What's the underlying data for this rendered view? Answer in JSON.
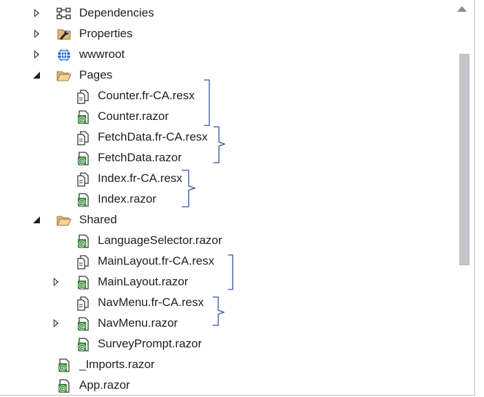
{
  "tree": {
    "items": [
      {
        "label": "Dependencies",
        "icon": "dependencies-icon",
        "expander": "collapsed"
      },
      {
        "label": "Properties",
        "icon": "properties-icon",
        "expander": "collapsed"
      },
      {
        "label": "wwwroot",
        "icon": "globe-icon",
        "expander": "collapsed"
      },
      {
        "label": "Pages",
        "icon": "folder-open-icon",
        "expander": "expanded"
      },
      {
        "label": "Counter.fr-CA.resx",
        "icon": "resx-file-icon",
        "expander": "none"
      },
      {
        "label": "Counter.razor",
        "icon": "razor-file-icon",
        "expander": "none"
      },
      {
        "label": "FetchData.fr-CA.resx",
        "icon": "resx-file-icon",
        "expander": "none"
      },
      {
        "label": "FetchData.razor",
        "icon": "razor-file-icon",
        "expander": "none"
      },
      {
        "label": "Index.fr-CA.resx",
        "icon": "resx-file-icon",
        "expander": "none"
      },
      {
        "label": "Index.razor",
        "icon": "razor-file-icon",
        "expander": "none"
      },
      {
        "label": "Shared",
        "icon": "folder-open-icon",
        "expander": "expanded"
      },
      {
        "label": "LanguageSelector.razor",
        "icon": "razor-file-icon",
        "expander": "none"
      },
      {
        "label": "MainLayout.fr-CA.resx",
        "icon": "resx-file-icon",
        "expander": "none"
      },
      {
        "label": "MainLayout.razor",
        "icon": "razor-file-icon",
        "expander": "collapsed"
      },
      {
        "label": "NavMenu.fr-CA.resx",
        "icon": "resx-file-icon",
        "expander": "none"
      },
      {
        "label": "NavMenu.razor",
        "icon": "razor-file-icon",
        "expander": "collapsed"
      },
      {
        "label": "SurveyPrompt.razor",
        "icon": "razor-file-icon",
        "expander": "none"
      },
      {
        "label": "_Imports.razor",
        "icon": "razor-file-icon",
        "expander": "none"
      },
      {
        "label": "App.razor",
        "icon": "razor-file-icon",
        "expander": "none"
      }
    ]
  },
  "colors": {
    "brace": "#2f4f9e",
    "razor_green": "#3a8a3a",
    "folder": "#dcb67a",
    "globe": "#1f6fd1",
    "text": "#1e1e1e"
  }
}
